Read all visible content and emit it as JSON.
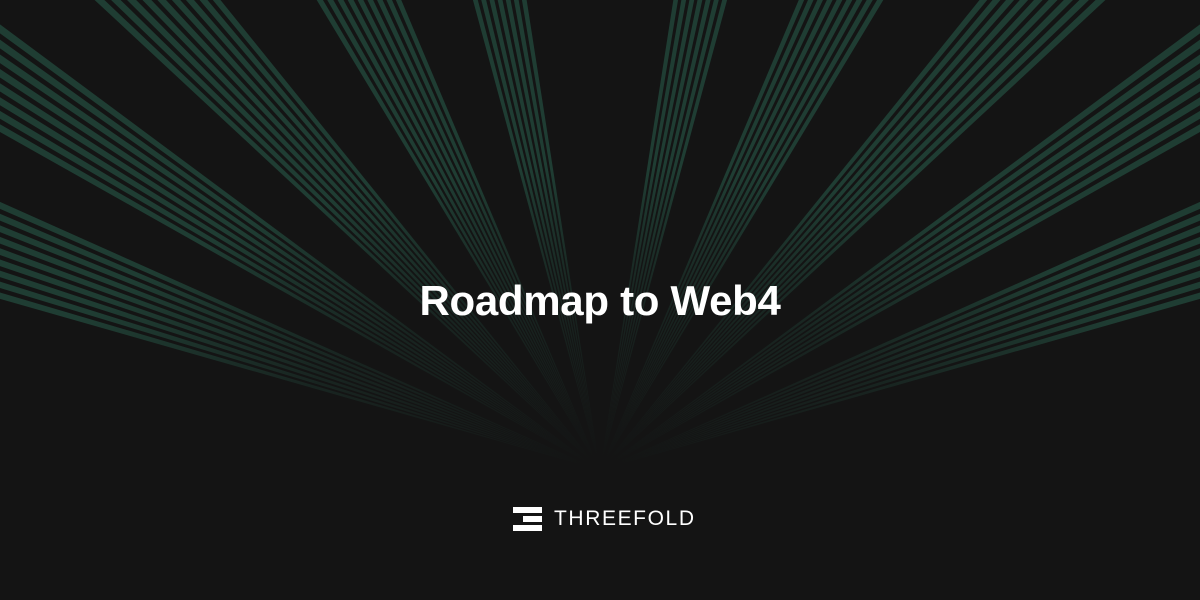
{
  "headline": "Roadmap to Web4",
  "brand": {
    "name": "THREEFOLD",
    "logo_icon": "threefold-logo-icon"
  },
  "colors": {
    "background": "#141414",
    "ray": "#1f3d33",
    "text": "#ffffff"
  }
}
